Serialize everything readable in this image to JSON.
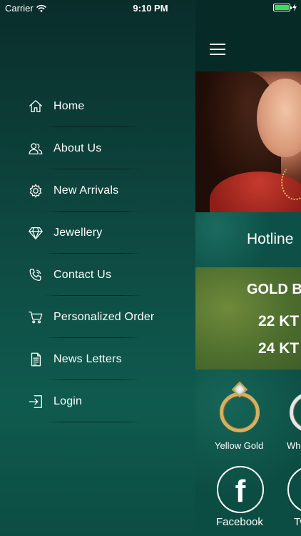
{
  "status_bar": {
    "carrier": "Carrier",
    "time": "9:10 PM",
    "battery_level": 1.0
  },
  "drawer": {
    "items": [
      {
        "label": "Home",
        "icon": "home-icon"
      },
      {
        "label": "About Us",
        "icon": "users-icon"
      },
      {
        "label": "New Arrivals",
        "icon": "gear-icon"
      },
      {
        "label": "Jewellery",
        "icon": "diamond-icon"
      },
      {
        "label": "Contact Us",
        "icon": "phone-icon"
      },
      {
        "label": "Personalized Order",
        "icon": "cart-icon"
      },
      {
        "label": "News Letters",
        "icon": "document-icon"
      },
      {
        "label": "Login",
        "icon": "login-icon"
      }
    ]
  },
  "main": {
    "hotline": "Hotline",
    "gold": {
      "title": "GOLD B",
      "rate_22": "22 KT",
      "rate_24": "24 KT"
    },
    "products": {
      "yellow_gold": "Yellow Gold",
      "white_gold": "Wh"
    },
    "social": {
      "facebook": "Facebook",
      "twitter": "Tw"
    }
  },
  "colors": {
    "drawer_top": "#0a2d2a",
    "drawer_mid": "#0f5a4e",
    "gold_band": "#5a7a35",
    "battery": "#3ddc54"
  }
}
